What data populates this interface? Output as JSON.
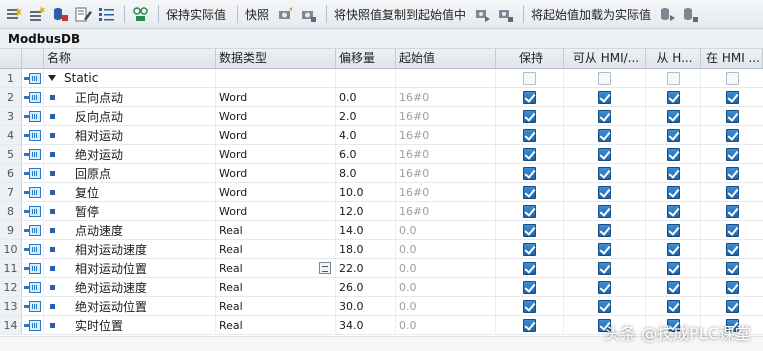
{
  "toolbar": {
    "icons": [
      "insert-row-icon",
      "add-row-icon",
      "snapshot-db-icon",
      "edit-icon",
      "list-icon",
      "monitor-icon"
    ],
    "keep_actual_label": "保持实际值",
    "snapshot_label": "快照",
    "copy_snapshot_label": "将快照值复制到起始值中",
    "load_start_label": "将起始值加载为实际值"
  },
  "db_title": "ModbusDB",
  "columns": {
    "name": "名称",
    "data_type": "数据类型",
    "offset": "偏移量",
    "start_value": "起始值",
    "retain": "保持",
    "hmi_access": "可从 HMI/...",
    "hmi_from": "从 H...",
    "hmi_in": "在 HMI ..."
  },
  "rows": [
    {
      "num": "1",
      "name": "Static",
      "type": "",
      "offset": "",
      "start": "",
      "retain": null,
      "h1": null,
      "h2": null,
      "h3": null
    },
    {
      "num": "2",
      "name": "正向点动",
      "type": "Word",
      "offset": "0.0",
      "start": "16#0",
      "retain": true,
      "h1": true,
      "h2": true,
      "h3": true
    },
    {
      "num": "3",
      "name": "反向点动",
      "type": "Word",
      "offset": "2.0",
      "start": "16#0",
      "retain": true,
      "h1": true,
      "h2": true,
      "h3": true
    },
    {
      "num": "4",
      "name": "相对运动",
      "type": "Word",
      "offset": "4.0",
      "start": "16#0",
      "retain": true,
      "h1": true,
      "h2": true,
      "h3": true
    },
    {
      "num": "5",
      "name": "绝对运动",
      "type": "Word",
      "offset": "6.0",
      "start": "16#0",
      "retain": true,
      "h1": true,
      "h2": true,
      "h3": true
    },
    {
      "num": "6",
      "name": "回原点",
      "type": "Word",
      "offset": "8.0",
      "start": "16#0",
      "retain": true,
      "h1": true,
      "h2": true,
      "h3": true
    },
    {
      "num": "7",
      "name": "复位",
      "type": "Word",
      "offset": "10.0",
      "start": "16#0",
      "retain": true,
      "h1": true,
      "h2": true,
      "h3": true
    },
    {
      "num": "8",
      "name": "暂停",
      "type": "Word",
      "offset": "12.0",
      "start": "16#0",
      "retain": true,
      "h1": true,
      "h2": true,
      "h3": true
    },
    {
      "num": "9",
      "name": "点动速度",
      "type": "Real",
      "offset": "14.0",
      "start": "0.0",
      "retain": true,
      "h1": true,
      "h2": true,
      "h3": true
    },
    {
      "num": "10",
      "name": "相对运动速度",
      "type": "Real",
      "offset": "18.0",
      "start": "0.0",
      "retain": true,
      "h1": true,
      "h2": true,
      "h3": true
    },
    {
      "num": "11",
      "name": "相对运动位置",
      "type": "Real",
      "offset": "22.0",
      "start": "0.0",
      "retain": true,
      "h1": true,
      "h2": true,
      "h3": true
    },
    {
      "num": "12",
      "name": "绝对运动速度",
      "type": "Real",
      "offset": "26.0",
      "start": "0.0",
      "retain": true,
      "h1": true,
      "h2": true,
      "h3": true
    },
    {
      "num": "13",
      "name": "绝对运动位置",
      "type": "Real",
      "offset": "30.0",
      "start": "0.0",
      "retain": true,
      "h1": true,
      "h2": true,
      "h3": true
    },
    {
      "num": "14",
      "name": "实时位置",
      "type": "Real",
      "offset": "34.0",
      "start": "0.0",
      "retain": true,
      "h1": true,
      "h2": true,
      "h3": true
    }
  ],
  "watermark": "头条 @技成PLC课堂",
  "colors": {
    "accent": "#2a77c4",
    "checkbox": "#1f64aa"
  }
}
